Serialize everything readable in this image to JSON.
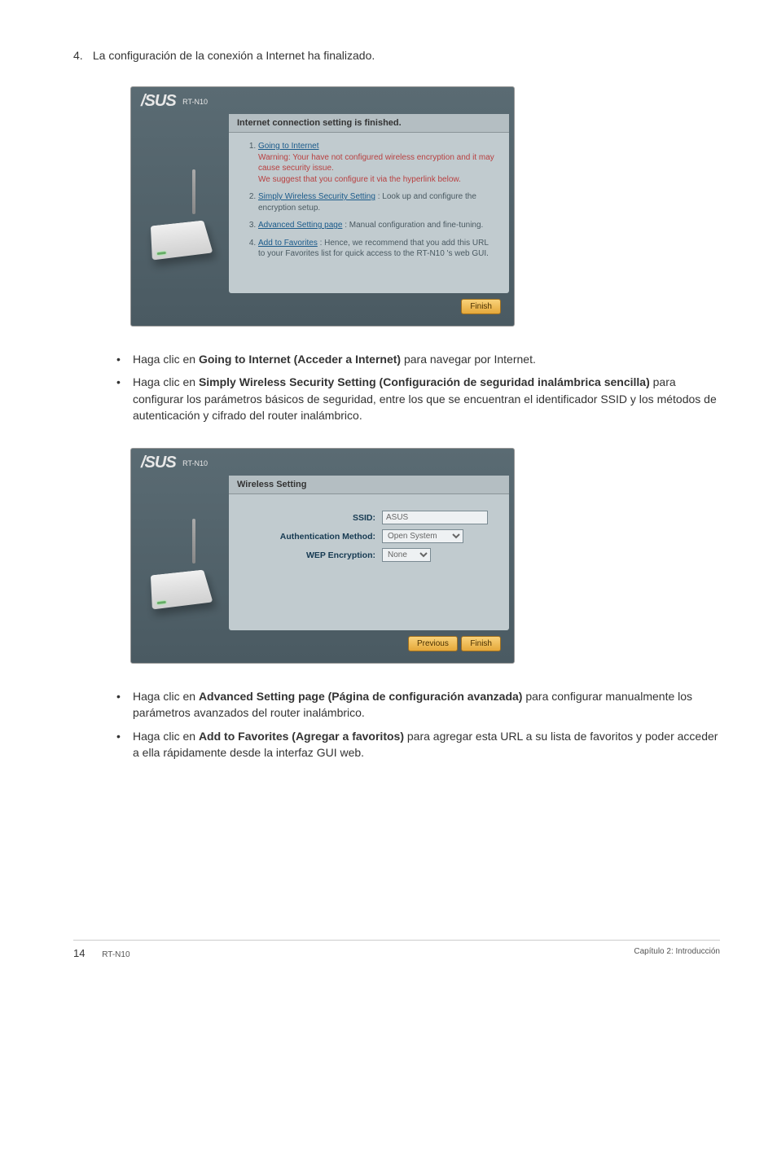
{
  "step": {
    "number": "4.",
    "text": "La configuración de la conexión a Internet ha finalizado."
  },
  "panel1": {
    "brand": "/SUS",
    "model": "RT-N10",
    "tab_title": "Internet connection setting is finished.",
    "items": [
      {
        "link": "Going to Internet",
        "warn1": "Warning: Your have not configured wireless encryption and it may cause security issue.",
        "warn2": "We suggest that you configure it via the hyperlink below."
      },
      {
        "link": "Simply Wireless Security Setting",
        "tail": " : Look up and configure the encryption setup."
      },
      {
        "link": "Advanced Setting page",
        "tail": " : Manual configuration and fine-tuning."
      },
      {
        "link": "Add to Favorites",
        "tail": " : Hence, we recommend that you add this URL to your Favorites list for quick access to the RT-N10  's web GUI."
      }
    ],
    "finish": "Finish"
  },
  "bullets_a": [
    {
      "pre": "Haga clic en ",
      "bold": "Going to Internet (Acceder a Internet)",
      "post": " para navegar por Internet."
    },
    {
      "pre": "Haga clic en ",
      "bold": "Simply Wireless Security Setting (Configuración de seguridad inalámbrica sencilla)",
      "post": " para configurar los parámetros básicos de seguridad, entre los que se encuentran el identificador SSID y los métodos de autenticación y cifrado del router inalámbrico."
    }
  ],
  "panel2": {
    "brand": "/SUS",
    "model": "RT-N10",
    "tab_title": "Wireless Setting",
    "fields": {
      "ssid_label": "SSID:",
      "ssid_value": "ASUS",
      "auth_label": "Authentication Method:",
      "auth_value": "Open System",
      "wep_label": "WEP Encryption:",
      "wep_value": "None"
    },
    "previous": "Previous",
    "finish": "Finish"
  },
  "bullets_b": [
    {
      "pre": "Haga clic en ",
      "bold": "Advanced Setting page (Página de configuración avanzada)",
      "post": " para configurar manualmente los parámetros avanzados del router inalámbrico."
    },
    {
      "pre": "Haga clic en ",
      "bold": "Add to Favorites (Agregar a favoritos)",
      "post": " para agregar esta URL a su lista de favoritos y poder acceder a ella rápidamente desde la interfaz GUI web."
    }
  ],
  "footer": {
    "page": "14",
    "product": "RT-N10",
    "chapter": "Capítulo 2: Introducción"
  }
}
